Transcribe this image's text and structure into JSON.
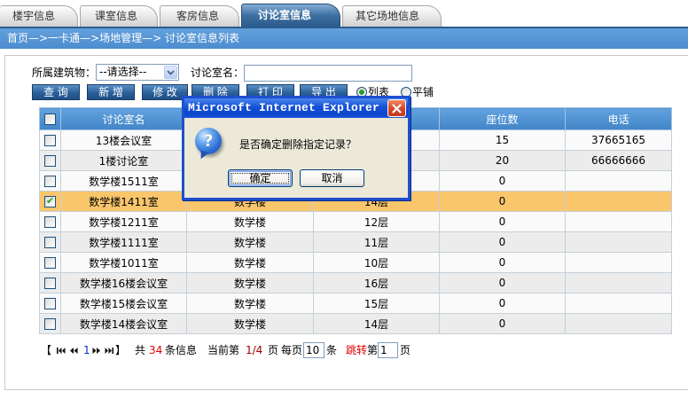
{
  "tabs": [
    {
      "label": "楼宇信息",
      "active": false
    },
    {
      "label": "课室信息",
      "active": false
    },
    {
      "label": "客房信息",
      "active": false
    },
    {
      "label": "讨论室信息",
      "active": true
    },
    {
      "label": "其它场地信息",
      "active": false
    }
  ],
  "breadcrumb": "首页—>一卡通—>场地管理—> 讨论室信息列表",
  "filter": {
    "building_label": "所属建筑物：",
    "building_selected": "--请选择--",
    "room_name_label": "讨论室名：",
    "room_name_value": ""
  },
  "toolbar": {
    "query_label": "查 询",
    "add_label": "新 增",
    "edit_label": "修 改",
    "delete_label": "删 除",
    "print_label": "打 印",
    "export_label": "导 出",
    "view_list_label": "列表",
    "view_tile_label": "平铺",
    "view_list_checked": true,
    "view_tile_checked": false
  },
  "table": {
    "headers": [
      "讨论室名",
      "",
      "",
      "座位数",
      "电话"
    ],
    "select_all_checked": false,
    "rows": [
      {
        "name": "13楼会议室",
        "building": "",
        "floor": "",
        "seats": "15",
        "phone": "37665165",
        "checked": false,
        "highlighted": false
      },
      {
        "name": "1楼讨论室",
        "building": "",
        "floor": "",
        "seats": "20",
        "phone": "66666666",
        "checked": false,
        "highlighted": false
      },
      {
        "name": "数学楼1511室",
        "building": "",
        "floor": "",
        "seats": "0",
        "phone": "",
        "checked": false,
        "highlighted": false
      },
      {
        "name": "数学楼1411室",
        "building": "数学楼",
        "floor": "14层",
        "seats": "0",
        "phone": "",
        "checked": true,
        "highlighted": true
      },
      {
        "name": "数学楼1211室",
        "building": "数学楼",
        "floor": "12层",
        "seats": "0",
        "phone": "",
        "checked": false,
        "highlighted": false
      },
      {
        "name": "数学楼1111室",
        "building": "数学楼",
        "floor": "11层",
        "seats": "0",
        "phone": "",
        "checked": false,
        "highlighted": false
      },
      {
        "name": "数学楼1011室",
        "building": "数学楼",
        "floor": "10层",
        "seats": "0",
        "phone": "",
        "checked": false,
        "highlighted": false
      },
      {
        "name": "数学楼16楼会议室",
        "building": "数学楼",
        "floor": "16层",
        "seats": "0",
        "phone": "",
        "checked": false,
        "highlighted": false
      },
      {
        "name": "数学楼15楼会议室",
        "building": "数学楼",
        "floor": "15层",
        "seats": "0",
        "phone": "",
        "checked": false,
        "highlighted": false
      },
      {
        "name": "数学楼14楼会议室",
        "building": "数学楼",
        "floor": "14层",
        "seats": "0",
        "phone": "",
        "checked": false,
        "highlighted": false
      }
    ]
  },
  "pagination": {
    "open_bracket": "【",
    "page_link": "1",
    "close_bracket": "】",
    "total_prefix": "共",
    "total_count": "34",
    "total_suffix": "条信息",
    "current_prefix": "当前第",
    "current_page": "1/4",
    "current_suffix": "页",
    "per_page_prefix": "每页",
    "per_page": "10",
    "per_page_suffix": "条",
    "jump_label": "跳转",
    "jump_prefix": "第",
    "jump_page": "1",
    "jump_suffix": "页"
  },
  "dialog": {
    "title": "Microsoft Internet Explorer",
    "message": "是否确定删除指定记录？",
    "ok_label": "确定",
    "cancel_label": "取消"
  },
  "colors": {
    "header_blue": "#4185c8",
    "breadcrumb_blue": "#4d8ccf",
    "button_blue": "#2a5f98",
    "row_alt": "#ececec",
    "row_highlight": "#f9c66c",
    "link_red": "#e00000",
    "dialog_frame": "#1f4fcf"
  }
}
